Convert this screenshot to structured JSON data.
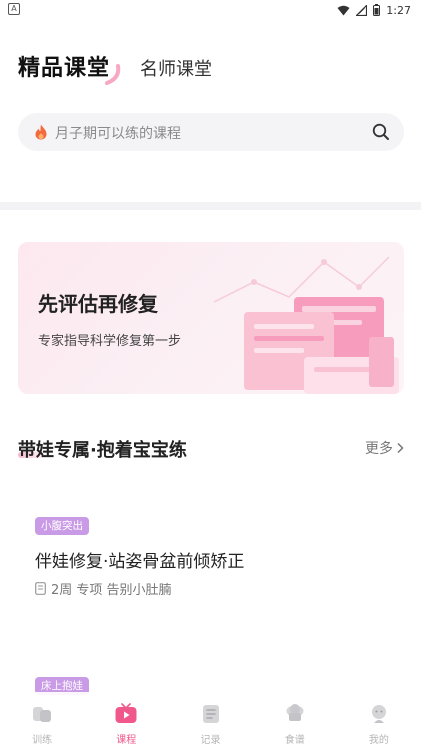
{
  "status_bar": {
    "left_badge": "A",
    "time": "1:27"
  },
  "header": {
    "tab_active": "精品课堂",
    "tab_inactive": "名师课堂"
  },
  "search": {
    "placeholder": "月子期可以练的课程"
  },
  "banner": {
    "title": "先评估再修复",
    "subtitle": "专家指导科学修复第一步"
  },
  "section": {
    "title": "带娃专属·抱着宝宝练",
    "more_label": "更多"
  },
  "courses": [
    {
      "tag": "小腹突出",
      "title": "伴娃修复·站姿骨盆前倾矫正",
      "meta": "2周 专项 告别小肚腩"
    },
    {
      "tag": "床上抱娃"
    }
  ],
  "bottom_nav": {
    "items": [
      {
        "label": "训练",
        "icon": "training-icon"
      },
      {
        "label": "课程",
        "icon": "course-play-icon"
      },
      {
        "label": "记录",
        "icon": "record-icon"
      },
      {
        "label": "食谱",
        "icon": "chef-hat-icon"
      },
      {
        "label": "我的",
        "icon": "profile-icon"
      }
    ],
    "active_index": 1
  },
  "colors": {
    "accent": "#f0588c",
    "tag_purple": "#c99be6",
    "banner_pink": "#fde8ef",
    "search_bg": "#f4f4f6"
  }
}
